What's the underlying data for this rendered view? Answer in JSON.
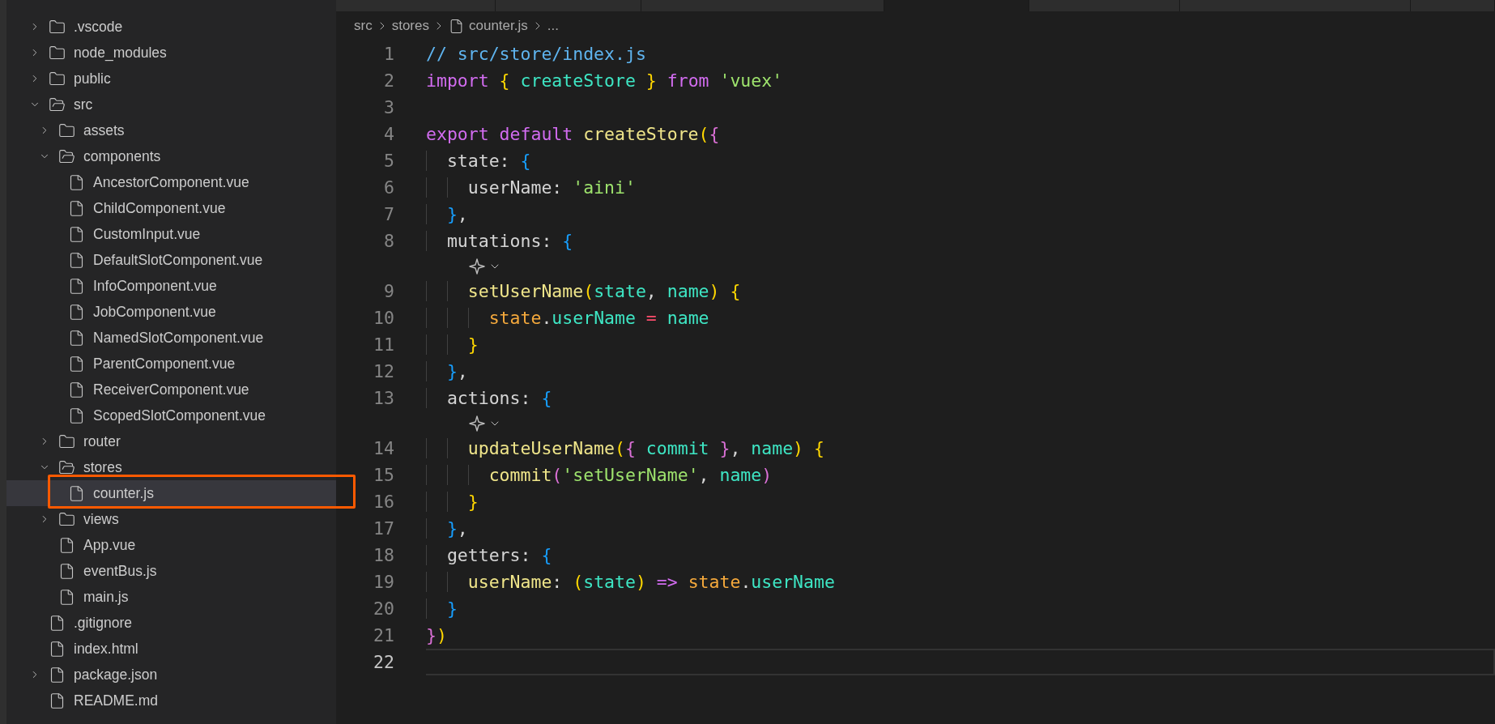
{
  "tabs": [
    {
      "selected": false
    },
    {
      "selected": false
    },
    {
      "selected": false
    },
    {
      "selected": true
    },
    {
      "selected": false
    },
    {
      "selected": false
    },
    {
      "selected": false
    }
  ],
  "explorer": {
    "items": [
      {
        "kind": "folder",
        "name": ".vscode",
        "expanded": false,
        "selected": false,
        "annotated": false
      },
      {
        "kind": "folder",
        "name": "node_modules",
        "expanded": false,
        "selected": false,
        "annotated": false
      },
      {
        "kind": "folder",
        "name": "public",
        "expanded": false,
        "selected": false,
        "annotated": false
      },
      {
        "kind": "folder",
        "name": "src",
        "expanded": true,
        "selected": false,
        "annotated": false,
        "children": [
          {
            "kind": "folder",
            "name": "assets",
            "expanded": false,
            "selected": false,
            "annotated": false
          },
          {
            "kind": "folder",
            "name": "components",
            "expanded": true,
            "selected": false,
            "annotated": false,
            "children": [
              {
                "kind": "file",
                "name": "AncestorComponent.vue",
                "selected": false,
                "annotated": false
              },
              {
                "kind": "file",
                "name": "ChildComponent.vue",
                "selected": false,
                "annotated": false
              },
              {
                "kind": "file",
                "name": "CustomInput.vue",
                "selected": false,
                "annotated": false
              },
              {
                "kind": "file",
                "name": "DefaultSlotComponent.vue",
                "selected": false,
                "annotated": false
              },
              {
                "kind": "file",
                "name": "InfoComponent.vue",
                "selected": false,
                "annotated": false
              },
              {
                "kind": "file",
                "name": "JobComponent.vue",
                "selected": false,
                "annotated": false
              },
              {
                "kind": "file",
                "name": "NamedSlotComponent.vue",
                "selected": false,
                "annotated": false
              },
              {
                "kind": "file",
                "name": "ParentComponent.vue",
                "selected": false,
                "annotated": false
              },
              {
                "kind": "file",
                "name": "ReceiverComponent.vue",
                "selected": false,
                "annotated": false
              },
              {
                "kind": "file",
                "name": "ScopedSlotComponent.vue",
                "selected": false,
                "annotated": false
              }
            ]
          },
          {
            "kind": "folder",
            "name": "router",
            "expanded": false,
            "selected": false,
            "annotated": false
          },
          {
            "kind": "folder",
            "name": "stores",
            "expanded": true,
            "selected": false,
            "annotated": false,
            "children": [
              {
                "kind": "file",
                "name": "counter.js",
                "selected": true,
                "annotated": true
              }
            ]
          },
          {
            "kind": "folder",
            "name": "views",
            "expanded": false,
            "selected": false,
            "annotated": false
          },
          {
            "kind": "file",
            "name": "App.vue",
            "selected": false,
            "annotated": false
          },
          {
            "kind": "file",
            "name": "eventBus.js",
            "selected": false,
            "annotated": false
          },
          {
            "kind": "file",
            "name": "main.js",
            "selected": false,
            "annotated": false
          }
        ]
      },
      {
        "kind": "file",
        "name": ".gitignore",
        "selected": false,
        "annotated": false
      },
      {
        "kind": "file",
        "name": "index.html",
        "selected": false,
        "annotated": false
      },
      {
        "kind": "file",
        "name": "package.json",
        "expanded": false,
        "selected": false,
        "annotated": false
      },
      {
        "kind": "file",
        "name": "README.md",
        "selected": false,
        "annotated": false
      }
    ]
  },
  "breadcrumbs": [
    {
      "kind": "folder",
      "text": "src"
    },
    {
      "kind": "folder",
      "text": "stores"
    },
    {
      "kind": "file",
      "text": "counter.js"
    },
    {
      "kind": "symbol",
      "text": "..."
    }
  ],
  "editor": {
    "lines": [
      {
        "kind": "code",
        "number": "1",
        "current": false,
        "tokens": [
          {
            "text": "// src/store/index.js",
            "kind": "comment"
          }
        ]
      },
      {
        "kind": "code",
        "number": "2",
        "current": false,
        "tokens": [
          {
            "text": "import ",
            "kind": "keyword"
          },
          {
            "text": "{",
            "kind": "b1"
          },
          {
            "text": " createStore ",
            "kind": "ident"
          },
          {
            "text": "}",
            "kind": "b1"
          },
          {
            "text": " from ",
            "kind": "keyword"
          },
          {
            "text": "'vuex'",
            "kind": "string"
          }
        ]
      },
      {
        "kind": "code",
        "number": "3",
        "current": false
      },
      {
        "kind": "code",
        "number": "4",
        "current": false,
        "tokens": [
          {
            "text": "export default ",
            "kind": "keyword"
          },
          {
            "text": "createStore",
            "kind": "func"
          },
          {
            "text": "(",
            "kind": "b1"
          },
          {
            "text": "{",
            "kind": "b2"
          }
        ]
      },
      {
        "kind": "code",
        "number": "5",
        "current": false,
        "tokens": [
          {
            "text": "  state: ",
            "kind": "plain"
          },
          {
            "text": "{",
            "kind": "b3"
          }
        ]
      },
      {
        "kind": "code",
        "number": "6",
        "current": false,
        "tokens": [
          {
            "text": "    userName: ",
            "kind": "plain"
          },
          {
            "text": "'aini'",
            "kind": "string"
          }
        ]
      },
      {
        "kind": "code",
        "number": "7",
        "current": false,
        "tokens": [
          {
            "text": "  }",
            "kind": "b3"
          },
          {
            "text": ",",
            "kind": "plain"
          }
        ]
      },
      {
        "kind": "code",
        "number": "8",
        "current": false,
        "tokens": [
          {
            "text": "  mutations: ",
            "kind": "plain"
          },
          {
            "text": "{",
            "kind": "b3"
          }
        ]
      },
      {
        "kind": "lens"
      },
      {
        "kind": "code",
        "number": "9",
        "current": false,
        "tokens": [
          {
            "text": "    setUserName",
            "kind": "func"
          },
          {
            "text": "(",
            "kind": "b1"
          },
          {
            "text": "state",
            "kind": "ident"
          },
          {
            "text": ", ",
            "kind": "plain"
          },
          {
            "text": "name",
            "kind": "ident"
          },
          {
            "text": ") {",
            "kind": "b1"
          }
        ]
      },
      {
        "kind": "code",
        "number": "10",
        "current": false,
        "tokens": [
          {
            "text": "      state",
            "kind": "var"
          },
          {
            "text": ".",
            "kind": "plain"
          },
          {
            "text": "userName",
            "kind": "ident"
          },
          {
            "text": " = ",
            "kind": "op"
          },
          {
            "text": "name",
            "kind": "ident"
          }
        ]
      },
      {
        "kind": "code",
        "number": "11",
        "current": false,
        "tokens": [
          {
            "text": "    }",
            "kind": "b1"
          }
        ]
      },
      {
        "kind": "code",
        "number": "12",
        "current": false,
        "tokens": [
          {
            "text": "  }",
            "kind": "b3"
          },
          {
            "text": ",",
            "kind": "plain"
          }
        ]
      },
      {
        "kind": "code",
        "number": "13",
        "current": false,
        "tokens": [
          {
            "text": "  actions: ",
            "kind": "plain"
          },
          {
            "text": "{",
            "kind": "b3"
          }
        ]
      },
      {
        "kind": "lens"
      },
      {
        "kind": "code",
        "number": "14",
        "current": false,
        "tokens": [
          {
            "text": "    updateUserName",
            "kind": "func"
          },
          {
            "text": "(",
            "kind": "b1"
          },
          {
            "text": "{",
            "kind": "b2"
          },
          {
            "text": " commit ",
            "kind": "ident"
          },
          {
            "text": "}",
            "kind": "b2"
          },
          {
            "text": ", ",
            "kind": "plain"
          },
          {
            "text": "name",
            "kind": "ident"
          },
          {
            "text": ") {",
            "kind": "b1"
          }
        ]
      },
      {
        "kind": "code",
        "number": "15",
        "current": false,
        "tokens": [
          {
            "text": "      commit",
            "kind": "func"
          },
          {
            "text": "(",
            "kind": "b2"
          },
          {
            "text": "'setUserName'",
            "kind": "string"
          },
          {
            "text": ", ",
            "kind": "plain"
          },
          {
            "text": "name",
            "kind": "ident"
          },
          {
            "text": ")",
            "kind": "b2"
          }
        ]
      },
      {
        "kind": "code",
        "number": "16",
        "current": false,
        "tokens": [
          {
            "text": "    }",
            "kind": "b1"
          }
        ]
      },
      {
        "kind": "code",
        "number": "17",
        "current": false,
        "tokens": [
          {
            "text": "  }",
            "kind": "b3"
          },
          {
            "text": ",",
            "kind": "plain"
          }
        ]
      },
      {
        "kind": "code",
        "number": "18",
        "current": false,
        "tokens": [
          {
            "text": "  getters: ",
            "kind": "plain"
          },
          {
            "text": "{",
            "kind": "b3"
          }
        ]
      },
      {
        "kind": "code",
        "number": "19",
        "current": false,
        "tokens": [
          {
            "text": "    userName",
            "kind": "func"
          },
          {
            "text": ": ",
            "kind": "plain"
          },
          {
            "text": "(",
            "kind": "b1"
          },
          {
            "text": "state",
            "kind": "ident"
          },
          {
            "text": ")",
            "kind": "b1"
          },
          {
            "text": " => ",
            "kind": "keyword"
          },
          {
            "text": "state",
            "kind": "var"
          },
          {
            "text": ".",
            "kind": "plain"
          },
          {
            "text": "userName",
            "kind": "ident"
          }
        ]
      },
      {
        "kind": "code",
        "number": "20",
        "current": false,
        "tokens": [
          {
            "text": "  }",
            "kind": "b3"
          }
        ]
      },
      {
        "kind": "code",
        "number": "21",
        "current": false,
        "tokens": [
          {
            "text": "}",
            "kind": "b2"
          },
          {
            "text": ")",
            "kind": "b1"
          }
        ]
      },
      {
        "kind": "code",
        "number": "22",
        "current": true
      }
    ]
  }
}
